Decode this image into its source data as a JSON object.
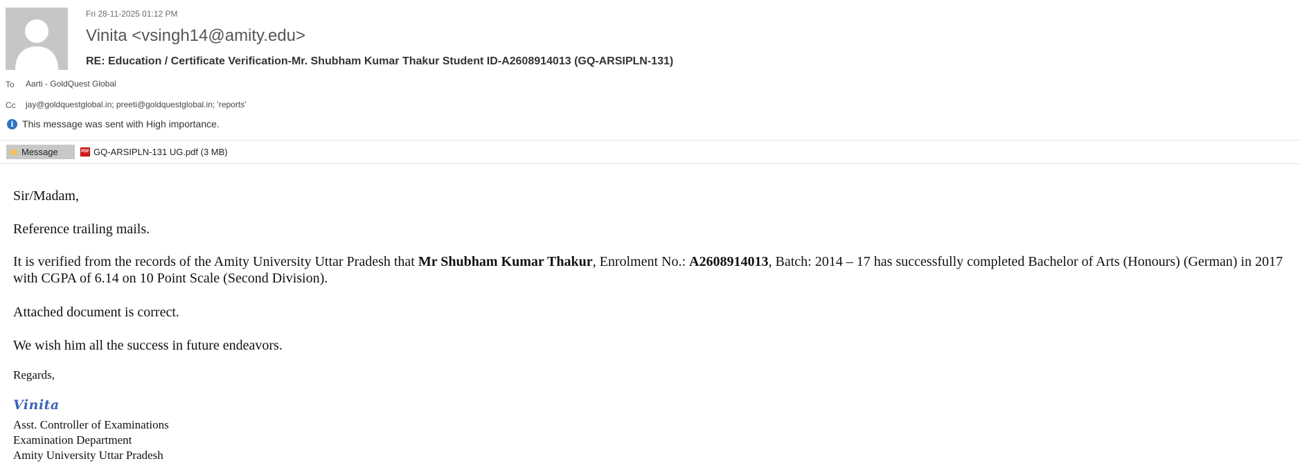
{
  "header": {
    "date": "Fri 28-11-2025 01:12 PM",
    "sender": "Vinita <vsingh14@amity.edu>",
    "subject": "RE: Education / Certificate Verification-Mr. Shubham Kumar Thakur Student ID-A2608914013 (GQ-ARSIPLN-131)",
    "to_label": "To",
    "to_value": "Aarti - GoldQuest Global",
    "cc_label": "Cc",
    "cc_value": "jay@goldquestglobal.in; preeti@goldquestglobal.in; 'reports'",
    "importance": "This message was sent with High importance."
  },
  "attachments": {
    "message_tab": "Message",
    "file": "GQ-ARSIPLN-131 UG.pdf (3 MB)"
  },
  "body": {
    "greeting": "Sir/Madam,",
    "reference": "Reference trailing mails.",
    "para_part1": "It is verified from the records of the Amity University Uttar Pradesh that ",
    "student_name": "Mr Shubham Kumar Thakur",
    "para_part2": ", Enrolment No.: ",
    "enrolment_no": "A2608914013",
    "para_part3": ", Batch: 2014 – 17 has successfully completed Bachelor of Arts (Honours) (German) in 2017 with CGPA of 6.14 on 10 Point Scale (Second Division).",
    "attached": "Attached document is correct.",
    "wish": "We wish him all the success in future endeavors.",
    "regards": "Regards,"
  },
  "signature": {
    "name": "Vinita",
    "title": "Asst. Controller of Examinations",
    "department": "Examination Department",
    "university": "Amity University Uttar Pradesh"
  },
  "colors": {
    "accent": "#2f72c2",
    "signature": "#3a63b8",
    "avatar_bg": "#c6c6c6"
  },
  "icons": [
    "avatar-icon",
    "info-icon",
    "envelope-icon",
    "pdf-icon"
  ]
}
